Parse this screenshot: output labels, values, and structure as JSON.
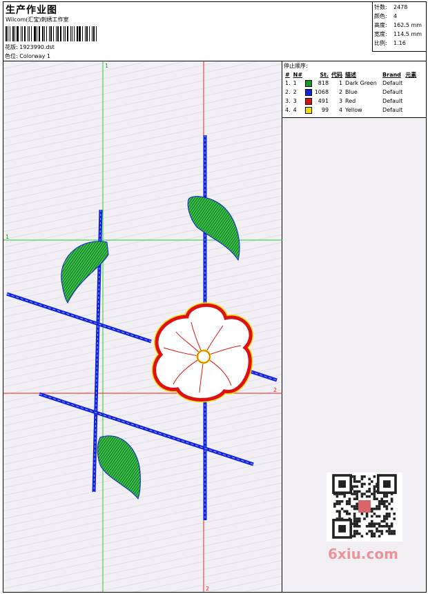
{
  "header": {
    "title": "生产作业图",
    "subtitle": "Wilcom(汇宝)刺绣工作室",
    "design_label": "花版:",
    "design_value": "1923990.dst",
    "colorway_label": "色位:",
    "colorway_value": "Colorway 1"
  },
  "stats": [
    {
      "label": "针数:",
      "value": "2478"
    },
    {
      "label": "颜色:",
      "value": "4"
    },
    {
      "label": "高度:",
      "value": "162.5 mm"
    },
    {
      "label": "宽度:",
      "value": "114.5 mm"
    },
    {
      "label": "比例:",
      "value": "1.16"
    }
  ],
  "stop_sequence": {
    "title": "停止顺序:",
    "columns": [
      "#",
      "N#",
      "St.",
      "代码",
      "描述",
      "Brand",
      "元素"
    ],
    "rows": [
      {
        "idx": "1.",
        "n": "1",
        "color": "#119922",
        "stitches": "818",
        "code": "1",
        "desc": "Dark Green",
        "brand": "Default"
      },
      {
        "idx": "2.",
        "n": "2",
        "color": "#1122dd",
        "stitches": "1068",
        "code": "2",
        "desc": "Blue",
        "brand": "Default"
      },
      {
        "idx": "3.",
        "n": "3",
        "color": "#dd1111",
        "stitches": "491",
        "code": "3",
        "desc": "Red",
        "brand": "Default"
      },
      {
        "idx": "4.",
        "n": "4",
        "color": "#eedd00",
        "stitches": "99",
        "code": "4",
        "desc": "Yellow",
        "brand": "Default"
      }
    ]
  },
  "axis_labels": {
    "green_top": "1",
    "green_left": "1",
    "red_right": "2",
    "red_bottom": "2"
  },
  "colors": {
    "leaf": "#119922",
    "stem": "#1122dd",
    "flower": "#dd1111",
    "center": "#eedd00",
    "guide_green": "#22cc22",
    "guide_red": "#ee2222"
  },
  "watermark": "6xiu.com"
}
